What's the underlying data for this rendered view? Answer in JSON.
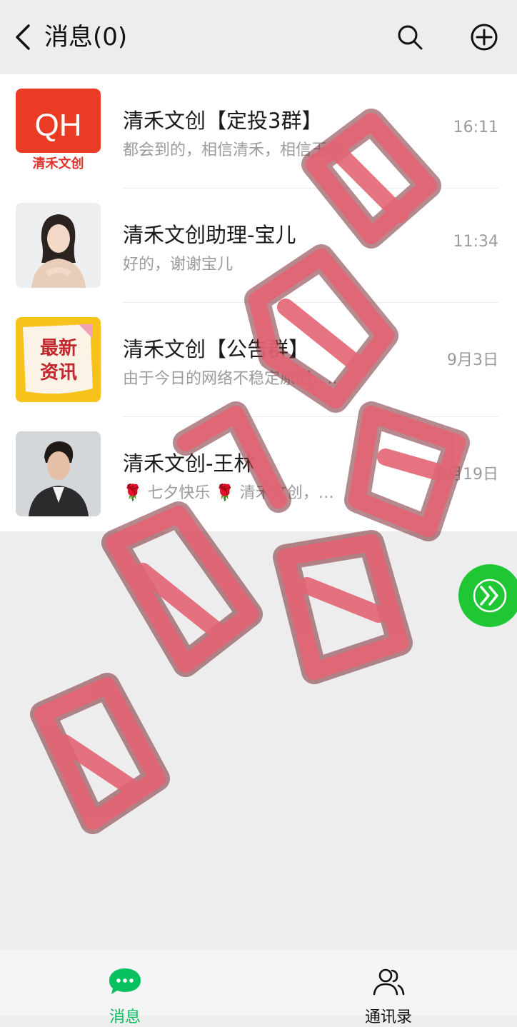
{
  "header": {
    "title": "消息(0)"
  },
  "icons": {
    "back": "back-arrow-icon",
    "search": "search-icon",
    "add": "add-circle-icon"
  },
  "conversations": [
    {
      "name": "清禾文创【定投3群】",
      "preview": "都会到的，相信清禾，相信王总",
      "time": "16:11",
      "avatar_text": "QH",
      "avatar_sub": "清禾文创"
    },
    {
      "name": "清禾文创助理-宝儿",
      "preview": "好的，谢谢宝儿",
      "time": "11:34"
    },
    {
      "name": "清禾文创【公告群】",
      "preview": "由于今日的网络不稳定原因，…",
      "time": "9月3日",
      "avatar_line1": "最新",
      "avatar_line2": "资讯"
    },
    {
      "name": "清禾文创-王林",
      "preview": "🌹 七夕快乐 🌹 清禾文创，…",
      "time": "8月19日"
    }
  ],
  "tabs": [
    {
      "label": "消息",
      "active": true,
      "color": "#07c160"
    },
    {
      "label": "通讯录",
      "active": false,
      "color": "#111111"
    }
  ],
  "colors": {
    "accent": "#07c160",
    "watermark": "#d9434f"
  }
}
